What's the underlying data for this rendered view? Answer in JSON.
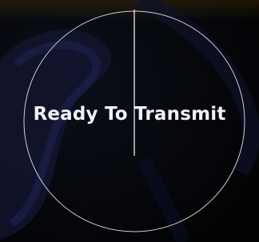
{
  "radar_display": {
    "status_message": "Ready To Transmit",
    "state": "standby",
    "range_ring_color": "#cfcfcf",
    "heading_line_color": "#ffffff",
    "text_color": "#f2f2f2",
    "background_color": "#030406",
    "watermark_color_top": "#f0a000",
    "watermark_color_body": "#1a1f4a"
  }
}
